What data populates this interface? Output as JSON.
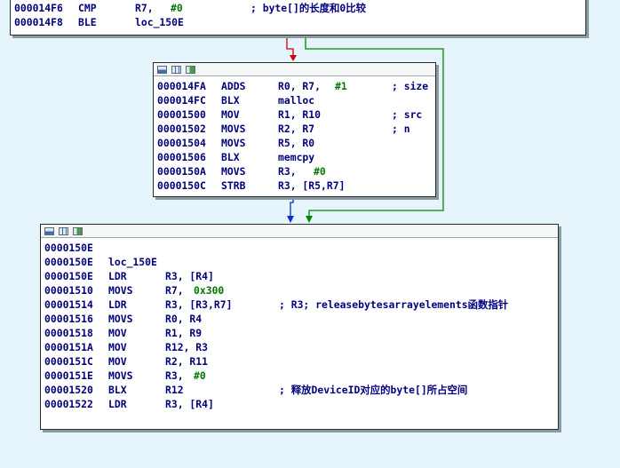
{
  "block_top": {
    "lines": [
      {
        "addr": "000014F6",
        "mn": "CMP",
        "op1": "R7, ",
        "op2": "#0",
        "comment": "; byte[]的长度和0比较"
      },
      {
        "addr": "000014F8",
        "mn": "BLE",
        "op1": "loc_150E",
        "op2": "",
        "comment": ""
      }
    ]
  },
  "block_mid": {
    "icons": [
      "graph-icon",
      "data-icon",
      "view-icon"
    ],
    "lines": [
      {
        "addr": "000014FA",
        "mn": "ADDS",
        "op1": "R0, R7, ",
        "op2": "#1",
        "comment": "; size"
      },
      {
        "addr": "000014FC",
        "mn": "BLX",
        "op1": "malloc",
        "op2": "",
        "comment": ""
      },
      {
        "addr": "00001500",
        "mn": "MOV",
        "op1": "R1, R10",
        "op2": "",
        "comment": "; src"
      },
      {
        "addr": "00001502",
        "mn": "MOVS",
        "op1": "R2, R7",
        "op2": "",
        "comment": "; n"
      },
      {
        "addr": "00001504",
        "mn": "MOVS",
        "op1": "R5, R0",
        "op2": "",
        "comment": ""
      },
      {
        "addr": "00001506",
        "mn": "BLX",
        "op1": "memcpy",
        "op2": "",
        "comment": ""
      },
      {
        "addr": "0000150A",
        "mn": "MOVS",
        "op1": "R3, ",
        "op2": "#0",
        "comment": ""
      },
      {
        "addr": "0000150C",
        "mn": "STRB",
        "op1": "R3, [R5,R7]",
        "op2": "",
        "comment": ""
      }
    ]
  },
  "block_bottom": {
    "icons": [
      "graph-icon",
      "data-icon",
      "view-icon"
    ],
    "lines": [
      {
        "addr": "0000150E",
        "mn": "",
        "op1": "",
        "op2": "",
        "comment": ""
      },
      {
        "addr": "0000150E",
        "mn": "loc_150E",
        "op1": "",
        "op2": "",
        "comment": ""
      },
      {
        "addr": "0000150E",
        "mn": "LDR",
        "op1": "R3, [R4]",
        "op2": "",
        "comment": ""
      },
      {
        "addr": "00001510",
        "mn": "MOVS",
        "op1": "R7, ",
        "op2": "0x300",
        "comment": ""
      },
      {
        "addr": "00001514",
        "mn": "LDR",
        "op1": "R3, [R3,R7]",
        "op2": "",
        "comment": "; R3; releasebytesarrayelements函数指针"
      },
      {
        "addr": "00001516",
        "mn": "MOVS",
        "op1": "R0, R4",
        "op2": "",
        "comment": ""
      },
      {
        "addr": "00001518",
        "mn": "MOV",
        "op1": "R1, R9",
        "op2": "",
        "comment": ""
      },
      {
        "addr": "0000151A",
        "mn": "MOV",
        "op1": "R12, R3",
        "op2": "",
        "comment": ""
      },
      {
        "addr": "0000151C",
        "mn": "MOV",
        "op1": "R2, R11",
        "op2": "",
        "comment": ""
      },
      {
        "addr": "0000151E",
        "mn": "MOVS",
        "op1": "R3, ",
        "op2": "#0",
        "comment": ""
      },
      {
        "addr": "00001520",
        "mn": "BLX",
        "op1": "R12",
        "op2": "",
        "comment": "; 释放DeviceID对应的byte[]所占空间"
      },
      {
        "addr": "00001522",
        "mn": "LDR",
        "op1": "R3, [R4]",
        "op2": "",
        "comment": ""
      }
    ]
  },
  "colors": {
    "background": "#e6f4fb",
    "edge_false": "#cc0000",
    "edge_true": "#008800",
    "edge_uncond": "#0033cc",
    "text": "#00007b",
    "immediate": "#007700"
  }
}
